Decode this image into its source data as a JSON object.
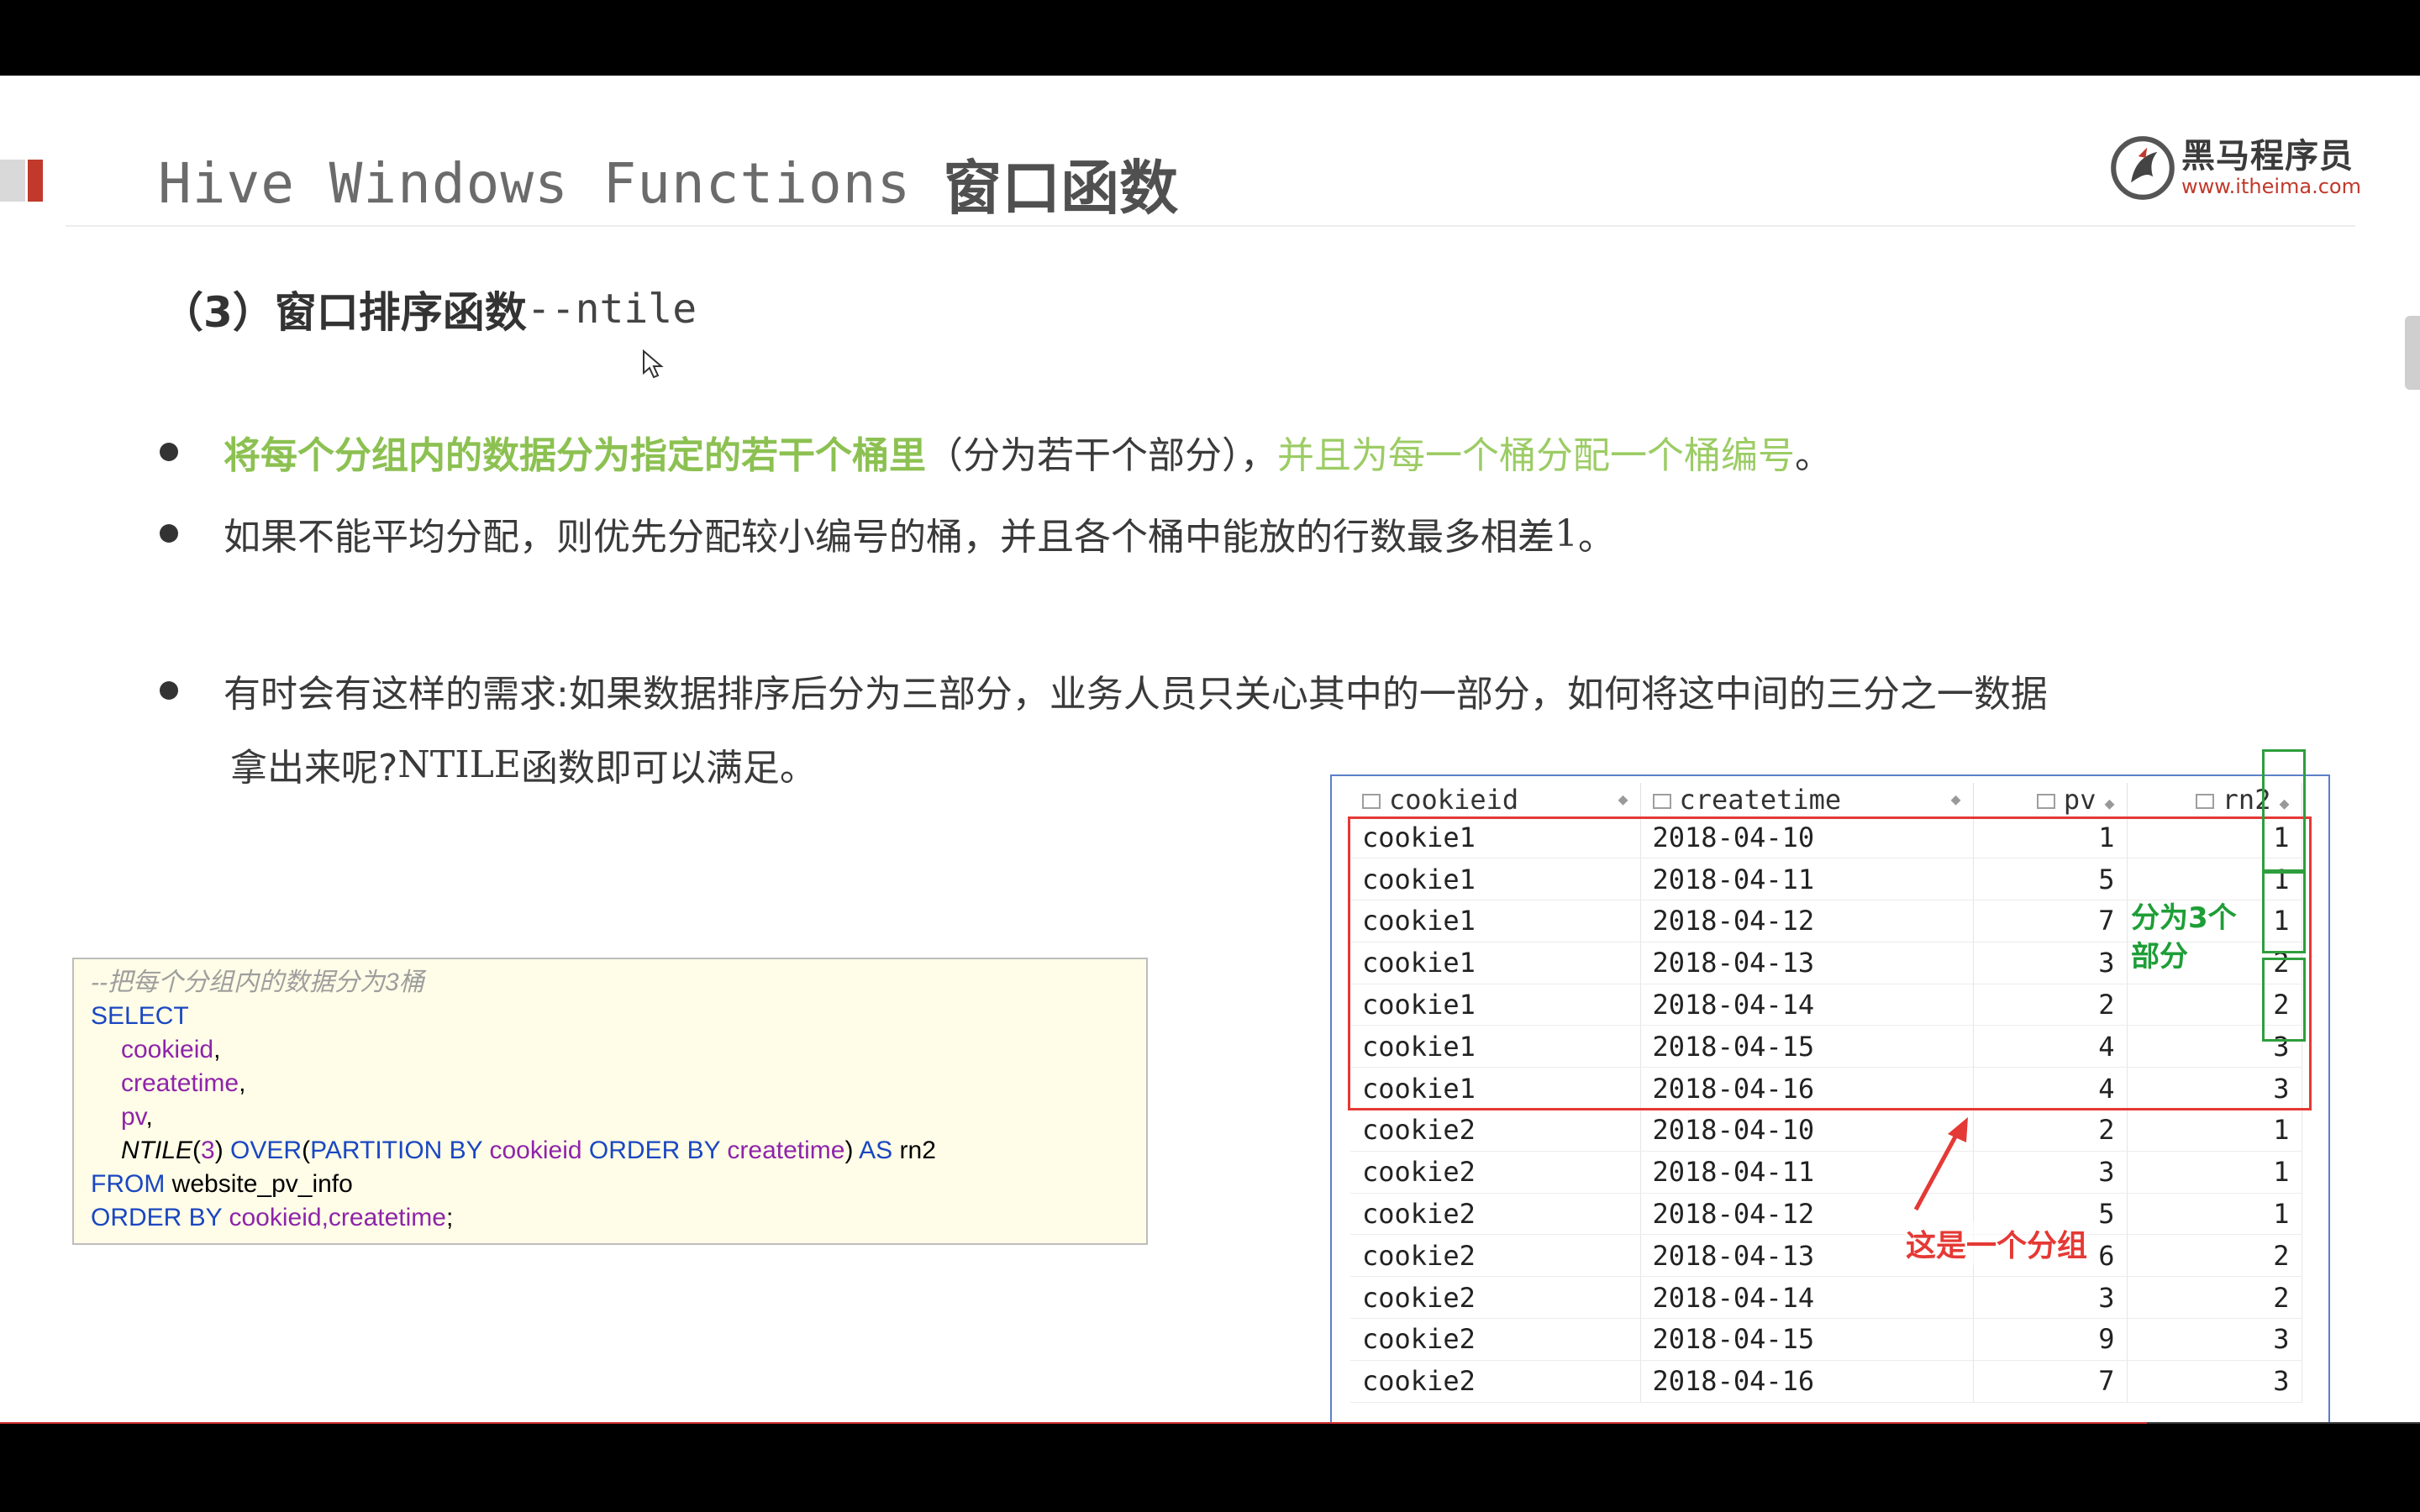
{
  "header": {
    "title_latin": "Hive Windows Functions",
    "title_cjk": "窗口函数"
  },
  "logo": {
    "name": "黑马程序员",
    "url": "www.itheima.com"
  },
  "subheading": {
    "number": "（3）",
    "text": "窗口排序函数",
    "code": "--ntile"
  },
  "bullets": [
    {
      "strong": "将每个分组内的数据分为指定的若干个桶里",
      "plain1": "（分为若干个部分），",
      "light": "并且为每一个桶分配一个桶编号",
      "plain2": "。"
    },
    {
      "text_a": "如果不能平均分配，则优先分配较小编号的桶，并且各个桶中能放的行数最多相差",
      "digit": "1",
      "text_b": "。"
    },
    {
      "line1": "有时会有这样的需求:如果数据排序后分为三部分，业务人员只关心其中的一部分，如何将这中间的三分之一数据",
      "line2_q": "拿出来呢?",
      "line2_code": "NTILE",
      "line2_end": "函数即可以满足。"
    }
  ],
  "code": {
    "comment": "--把每个分组内的数据分为3桶",
    "select": "SELECT",
    "col1": "cookieid",
    "col2": "createtime",
    "col3": "pv",
    "fn": "NTILE",
    "fn_arg": "3",
    "over": "OVER",
    "partition": "PARTITION BY",
    "part_col": "cookieid",
    "order": "ORDER BY",
    "order_col": "createtime",
    "as": "AS",
    "alias": "rn2",
    "from": "FROM",
    "table": "website_pv_info",
    "order2": "ORDER BY",
    "order2_cols": "cookieid,createtime",
    "comma": ",",
    "semi": ";"
  },
  "table": {
    "columns": [
      "cookieid",
      "createtime",
      "pv",
      "rn2"
    ],
    "rows": [
      [
        "cookie1",
        "2018-04-10",
        "1",
        "1"
      ],
      [
        "cookie1",
        "2018-04-11",
        "5",
        "1"
      ],
      [
        "cookie1",
        "2018-04-12",
        "7",
        "1"
      ],
      [
        "cookie1",
        "2018-04-13",
        "3",
        "2"
      ],
      [
        "cookie1",
        "2018-04-14",
        "2",
        "2"
      ],
      [
        "cookie1",
        "2018-04-15",
        "4",
        "3"
      ],
      [
        "cookie1",
        "2018-04-16",
        "4",
        "3"
      ],
      [
        "cookie2",
        "2018-04-10",
        "2",
        "1"
      ],
      [
        "cookie2",
        "2018-04-11",
        "3",
        "1"
      ],
      [
        "cookie2",
        "2018-04-12",
        "5",
        "1"
      ],
      [
        "cookie2",
        "2018-04-13",
        "6",
        "2"
      ],
      [
        "cookie2",
        "2018-04-14",
        "3",
        "2"
      ],
      [
        "cookie2",
        "2018-04-15",
        "9",
        "3"
      ],
      [
        "cookie2",
        "2018-04-16",
        "7",
        "3"
      ]
    ]
  },
  "annotations": {
    "bucket_label_1": "分为3个",
    "bucket_label_2": "部分",
    "group_label": "这是一个分组"
  },
  "progress": {
    "fraction": 0.887
  },
  "colors": {
    "accent_red": "#c0392b",
    "green": "#8cc152",
    "annotation_green": "#1e9e37",
    "annotation_red": "#e53935",
    "code_keyword": "#1a47c2",
    "code_identifier": "#8e24aa"
  }
}
